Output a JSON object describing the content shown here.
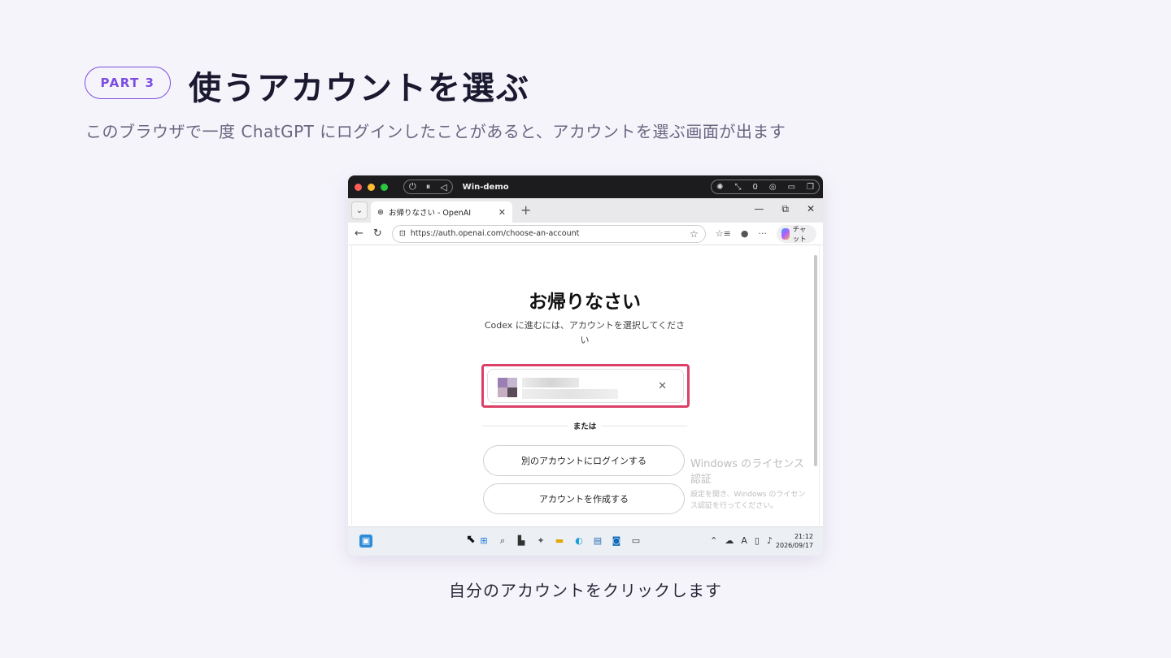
{
  "header": {
    "badge": "PART 3",
    "title": "使うアカウントを選ぶ",
    "subtitle": "このブラウザで一度 ChatGPT にログインしたことがあると、アカウントを選ぶ画面が出ます"
  },
  "caption": "自分のアカウントをクリックします",
  "vm_bar": {
    "name": "Win-demo",
    "counter": "0"
  },
  "browser": {
    "tab_title": "お帰りなさい - OpenAI",
    "url": "https://auth.openai.com/choose-an-account",
    "chat_label": "チャット"
  },
  "page": {
    "title": "お帰りなさい",
    "subtitle": "Codex に進むには、アカウントを選択してください",
    "or": "または",
    "login_other": "別のアカウントにログインする",
    "create_account": "アカウントを作成する"
  },
  "watermark": {
    "title": "Windows のライセンス認証",
    "body": "設定を開き、Windows のライセンス認証を行ってください。"
  },
  "taskbar": {
    "time": "21:12",
    "date": "2026/09/17"
  },
  "colors": {
    "accent": "#7c4ddf",
    "highlight": "#dc3f67"
  }
}
